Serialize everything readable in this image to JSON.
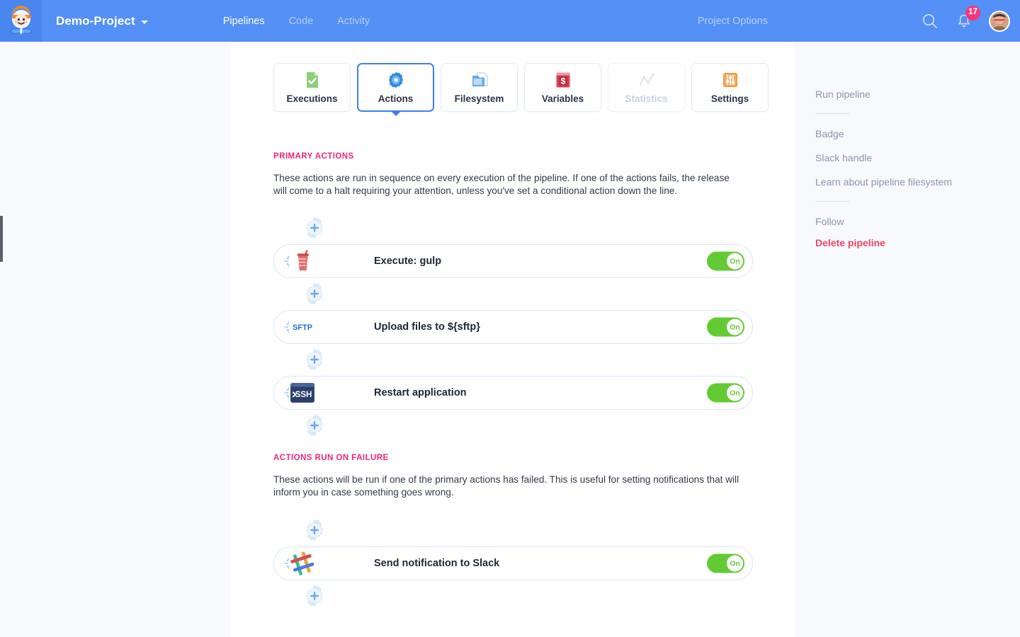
{
  "topbar": {
    "logo_icon": "buddy-mascot-logo",
    "project_name": "Demo-Project",
    "caret_icon": "chevron-down-icon",
    "nav": [
      {
        "label": "Pipelines",
        "active": true
      },
      {
        "label": "Code",
        "active": false
      },
      {
        "label": "Activity",
        "active": false
      }
    ],
    "project_options_label": "Project Options",
    "search_icon": "search-icon",
    "bell_icon": "bell-icon",
    "notification_count": "17",
    "avatar_icon": "user-avatar"
  },
  "tabs": [
    {
      "label": "Executions",
      "icon": "document-check-icon",
      "state": "default"
    },
    {
      "label": "Actions",
      "icon": "gear-icon",
      "state": "active"
    },
    {
      "label": "Filesystem",
      "icon": "folder-files-icon",
      "state": "default"
    },
    {
      "label": "Variables",
      "icon": "dollar-book-icon",
      "state": "default"
    },
    {
      "label": "Statistics",
      "icon": "line-chart-icon",
      "state": "disabled"
    },
    {
      "label": "Settings",
      "icon": "sliders-icon",
      "state": "default"
    }
  ],
  "primary_section": {
    "title": "PRIMARY ACTIONS",
    "description": "These actions are run in sequence on every execution of the pipeline. If one of the actions fails, the release will come to a halt requiring your attention, unless you've set a conditional action down the line.",
    "actions": [
      {
        "title": "Execute: gulp",
        "icon": "gulp-icon",
        "toggle_label": "On",
        "toggle_state": "on"
      },
      {
        "title": "Upload files to ${sftp}",
        "icon": "sftp-icon",
        "toggle_label": "On",
        "toggle_state": "on"
      },
      {
        "title": "Restart application",
        "icon": "ssh-icon",
        "toggle_label": "On",
        "toggle_state": "on"
      }
    ]
  },
  "failure_section": {
    "title": "ACTIONS RUN ON FAILURE",
    "description": "These actions will be run if one of the primary actions has failed. This is useful for setting notifications that will inform you in case something goes wrong.",
    "actions": [
      {
        "title": "Send notification to Slack",
        "icon": "slack-icon",
        "toggle_label": "On",
        "toggle_state": "on"
      }
    ]
  },
  "add_action_icon": "plus-gear-icon",
  "drag_handle_icon": "sort-updown-icon",
  "right_rail": {
    "run_pipeline": "Run pipeline",
    "badge": "Badge",
    "slack_handle": "Slack handle",
    "learn_filesystem": "Learn about pipeline filesystem",
    "follow": "Follow",
    "delete_pipeline": "Delete pipeline"
  },
  "colors": {
    "brand_blue": "#5490f5",
    "accent_pink": "#f2257a",
    "toggle_green": "#62cb33",
    "danger_red": "#f0455e",
    "badge_pink": "#f4387c"
  }
}
